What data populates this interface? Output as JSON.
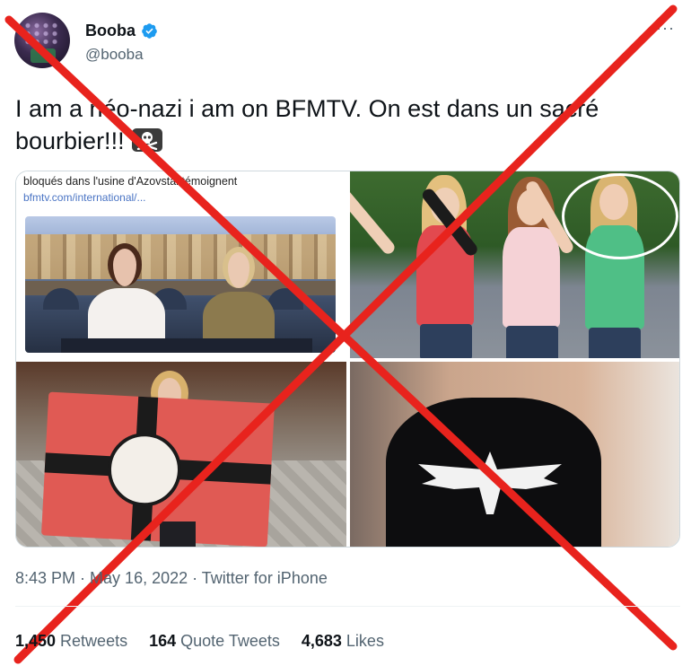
{
  "user": {
    "display_name": "Booba",
    "handle": "@booba",
    "verified": true,
    "avatar_icon": "avatar-image"
  },
  "more_icon": "more-horizontal-icon",
  "more_glyph": "···",
  "tweet": {
    "text": "I am a néo-nazi i am on BFMTV. On est dans un sacré bourbier!!!",
    "emoji": "skull-and-crossbones-icon"
  },
  "media": {
    "image_count": 4,
    "screenshot_caption": "bloqués dans l'usine d'Azovstal témoignent",
    "screenshot_url": "bfmtv.com/international/..."
  },
  "meta": {
    "time": "8:43 PM",
    "separator": " · ",
    "date": "May 16, 2022",
    "source": "Twitter for iPhone"
  },
  "stats": {
    "retweets_count": "1,450",
    "retweets_label": "Retweets",
    "quotes_count": "164",
    "quotes_label": "Quote Tweets",
    "likes_count": "4,683",
    "likes_label": "Likes"
  },
  "overlay": {
    "color": "#e8231d",
    "meaning": "red-cross-out-x"
  },
  "colors": {
    "text_primary": "#0f1419",
    "text_secondary": "#536471",
    "verified_blue": "#1d9bf0",
    "link_blue": "#4a74c4"
  }
}
